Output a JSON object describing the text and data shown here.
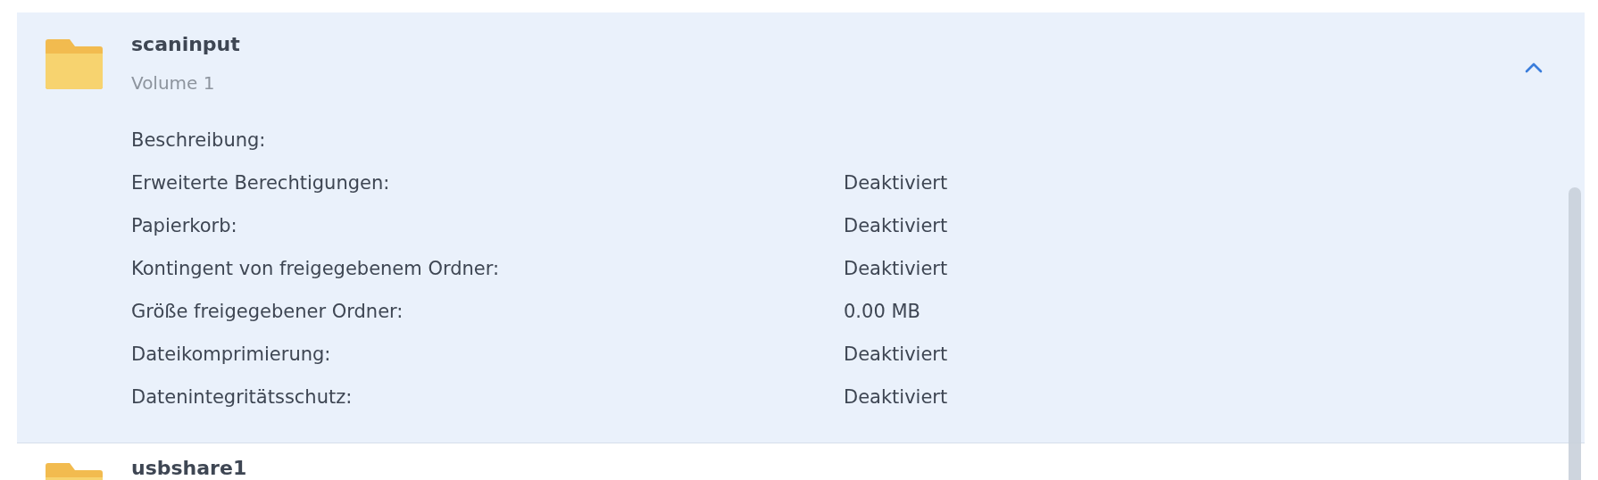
{
  "folders": [
    {
      "name": "scaninput",
      "volume": "Volume 1",
      "expanded": true,
      "details": [
        {
          "label": "Beschreibung:"
        },
        {
          "label": "Erweiterte Berechtigungen:",
          "value": "Deaktiviert"
        },
        {
          "label": "Papierkorb:",
          "value": "Deaktiviert"
        },
        {
          "label": "Kontingent von freigegebenem Ordner:",
          "value": "Deaktiviert"
        },
        {
          "label": "Größe freigegebener Ordner:",
          "value": "0.00 MB"
        },
        {
          "label": "Dateikomprimierung:",
          "value": "Deaktiviert"
        },
        {
          "label": "Datenintegritätsschutz:",
          "value": "Deaktiviert"
        }
      ]
    },
    {
      "name": "usbshare1",
      "expanded": false
    }
  ]
}
